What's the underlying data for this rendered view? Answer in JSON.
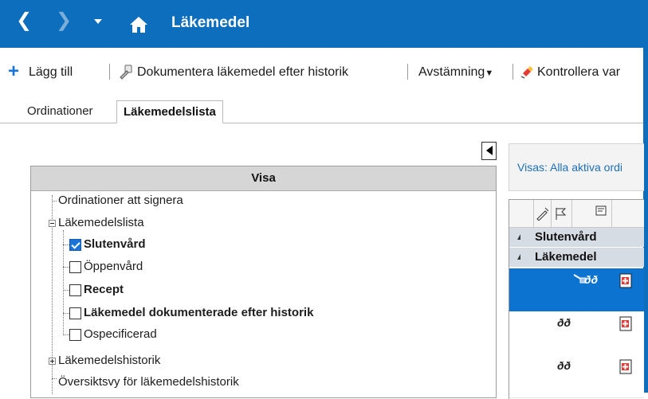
{
  "titlebar": {
    "title": "Läkemedel",
    "back_icon": "chevron-left-icon",
    "forward_icon": "chevron-right-icon",
    "home_icon": "home-icon"
  },
  "toolbar": {
    "add_label": "Lägg till",
    "document_label": "Dokumentera läkemedel efter historik",
    "reconcile_label": "Avstämning",
    "check_label": "Kontrollera var"
  },
  "tabs": [
    {
      "label": "Ordinationer",
      "active": false
    },
    {
      "label": "Läkemedelslista",
      "active": true
    }
  ],
  "visa": {
    "header": "Visa",
    "items": [
      {
        "label": "Ordinationer att signera"
      },
      {
        "label": "Läkemedelslista"
      },
      {
        "label": "Slutenvård",
        "checked": true
      },
      {
        "label": "Öppenvård",
        "checked": false
      },
      {
        "label": "Recept",
        "checked": false
      },
      {
        "label": "Läkemedel dokumenterade efter historik",
        "checked": false
      },
      {
        "label": "Ospecificerad",
        "checked": false
      },
      {
        "label": "Läkemedelshistorik"
      },
      {
        "label": "Översiktsvy för läkemedelshistorik"
      }
    ]
  },
  "right_panel": {
    "info_text": "Visas: Alla aktiva ordi",
    "groups": [
      {
        "label": "Slutenvård"
      },
      {
        "label": "Läkemedel"
      }
    ],
    "glasses_glyph": "ðð",
    "colors": {
      "selection": "#0c73d1",
      "group_bg": "#d6dce4",
      "titlebar": "#0c6ebc"
    }
  }
}
